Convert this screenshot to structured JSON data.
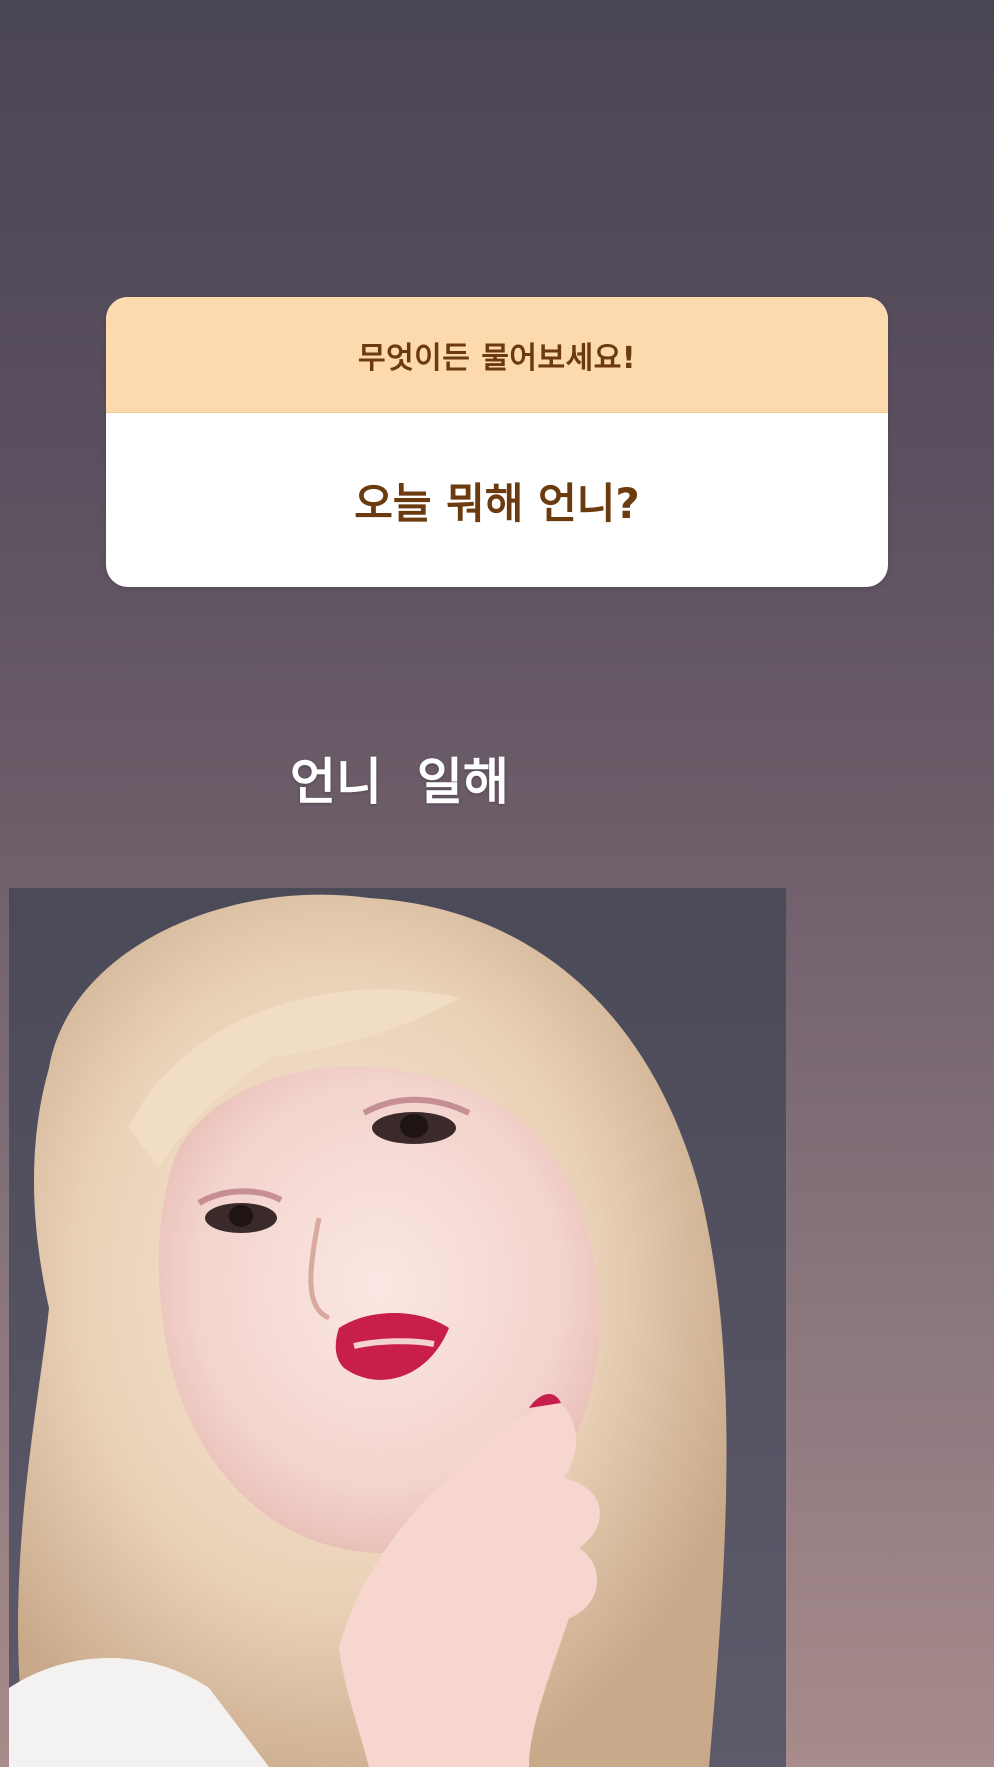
{
  "question_sticker": {
    "prompt": "무엇이든 물어보세요!",
    "question": "오늘 뭐해 언니?"
  },
  "caption": {
    "text": "언니  일해"
  },
  "photo": {
    "description_icon": "portrait-photo"
  },
  "colors": {
    "header_bg": "#fdd9ae",
    "question_text": "#6b3a0e",
    "caption_text": "#ffffff"
  }
}
